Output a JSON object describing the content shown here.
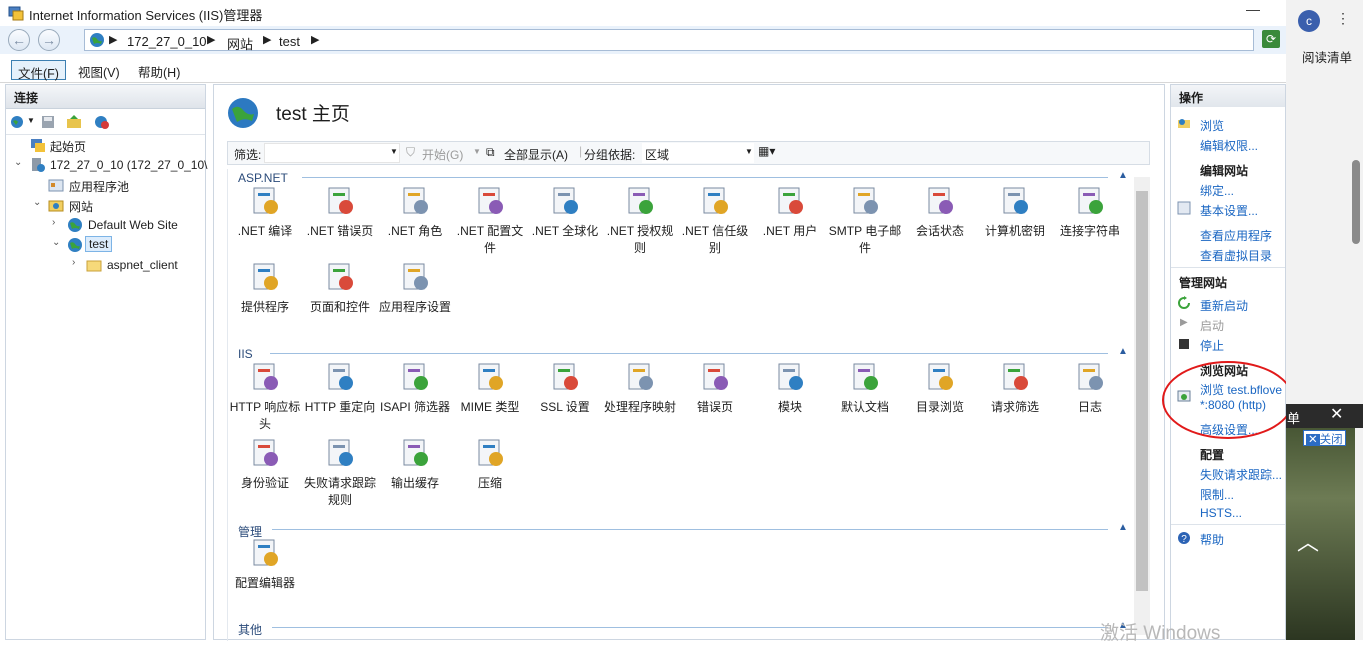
{
  "window": {
    "title": "Internet Information Services (IIS)管理器"
  },
  "address": {
    "crumbs": [
      "172_27_0_10",
      "网站",
      "test"
    ]
  },
  "menu": {
    "items": [
      "文件(F)",
      "视图(V)",
      "帮助(H)"
    ]
  },
  "connections": {
    "header": "连接",
    "tree": [
      {
        "label": "起始页"
      },
      {
        "label": "172_27_0_10 (172_27_0_10\\"
      },
      {
        "label": "应用程序池"
      },
      {
        "label": "网站"
      },
      {
        "label": "Default Web Site"
      },
      {
        "label": "test"
      },
      {
        "label": "aspnet_client"
      }
    ]
  },
  "center": {
    "title": "test 主页",
    "filter_label": "筛选:",
    "start_label": "开始(G)",
    "show_all_label": "全部显示(A)",
    "group_by_label": "分组依据:",
    "group_by_value": "区域",
    "groups": [
      {
        "name": "ASP.NET",
        "features": [
          {
            "label": ".NET 编译",
            "icon": "download-arrow-icon"
          },
          {
            "label": ".NET 错误页",
            "icon": "404-warning-icon"
          },
          {
            "label": ".NET 角色",
            "icon": "roles-document-icon"
          },
          {
            "label": ".NET 配置文件",
            "icon": "profile-forms-icon"
          },
          {
            "label": ".NET 全球化",
            "icon": "globe-icon"
          },
          {
            "label": ".NET 授权规则",
            "icon": "lock-document-icon"
          },
          {
            "label": ".NET 信任级别",
            "icon": "trust-globe-check-icon"
          },
          {
            "label": ".NET 用户",
            "icon": "users-icon"
          },
          {
            "label": "SMTP 电子邮件",
            "icon": "smtp-mail-icon"
          },
          {
            "label": "会话状态",
            "icon": "session-user-icon"
          },
          {
            "label": "计算机密钥",
            "icon": "machine-key-icon"
          },
          {
            "label": "连接字符串",
            "icon": "database-ab-icon"
          },
          {
            "label": "提供程序",
            "icon": "provider-db-user-icon"
          },
          {
            "label": "页面和控件",
            "icon": "pages-controls-icon"
          },
          {
            "label": "应用程序设置",
            "icon": "app-settings-icon"
          }
        ]
      },
      {
        "name": "IIS",
        "features": [
          {
            "label": "HTTP 响应标头",
            "icon": "http-headers-icon"
          },
          {
            "label": "HTTP 重定向",
            "icon": "http-redirect-icon"
          },
          {
            "label": "ISAPI 筛选器",
            "icon": "isapi-filter-icon"
          },
          {
            "label": "MIME 类型",
            "icon": "mime-music-icon"
          },
          {
            "label": "SSL 设置",
            "icon": "ssl-lock-icon"
          },
          {
            "label": "处理程序映射",
            "icon": "handler-arrows-icon"
          },
          {
            "label": "错误页",
            "icon": "error-404-icon"
          },
          {
            "label": "模块",
            "icon": "modules-icon"
          },
          {
            "label": "默认文档",
            "icon": "default-doc-check-icon"
          },
          {
            "label": "目录浏览",
            "icon": "directory-browse-icon"
          },
          {
            "label": "请求筛选",
            "icon": "request-filter-icon"
          },
          {
            "label": "日志",
            "icon": "log-book-icon"
          },
          {
            "label": "身份验证",
            "icon": "auth-user-lock-icon"
          },
          {
            "label": "失败请求跟踪规则",
            "icon": "failed-request-icon"
          },
          {
            "label": "输出缓存",
            "icon": "output-cache-icon"
          },
          {
            "label": "压缩",
            "icon": "compression-clamp-icon"
          }
        ]
      },
      {
        "name": "管理",
        "features": [
          {
            "label": "配置编辑器",
            "icon": "config-editor-icon"
          }
        ]
      },
      {
        "name": "其他",
        "features": []
      }
    ]
  },
  "actions": {
    "header": "操作",
    "browse": "浏览",
    "edit_perms": "编辑权限...",
    "edit_site": "编辑网站",
    "bindings": "绑定...",
    "basic_settings": "基本设置...",
    "view_apps": "查看应用程序",
    "view_vdirs": "查看虚拟目录",
    "manage_site": "管理网站",
    "restart": "重新启动",
    "start": "启动",
    "stop": "停止",
    "browse_site": "浏览网站",
    "browse_test_line1": "浏览 test.bflove",
    "browse_test_line2": "*:8080 (http)",
    "advanced_settings": "高级设置...",
    "config": "配置",
    "failed_tracing": "失败请求跟踪...",
    "limits": "限制...",
    "hsts": "HSTS...",
    "help": "帮助"
  },
  "browser": {
    "profile_initial": "c",
    "reading_list": "阅读清单",
    "popup_title": "单",
    "popup_close": "关闭"
  },
  "watermark": "激活 Windows",
  "colors": {
    "link": "#1a66c2",
    "annotation": "#e11a1a",
    "selection": "#dcecfc"
  }
}
